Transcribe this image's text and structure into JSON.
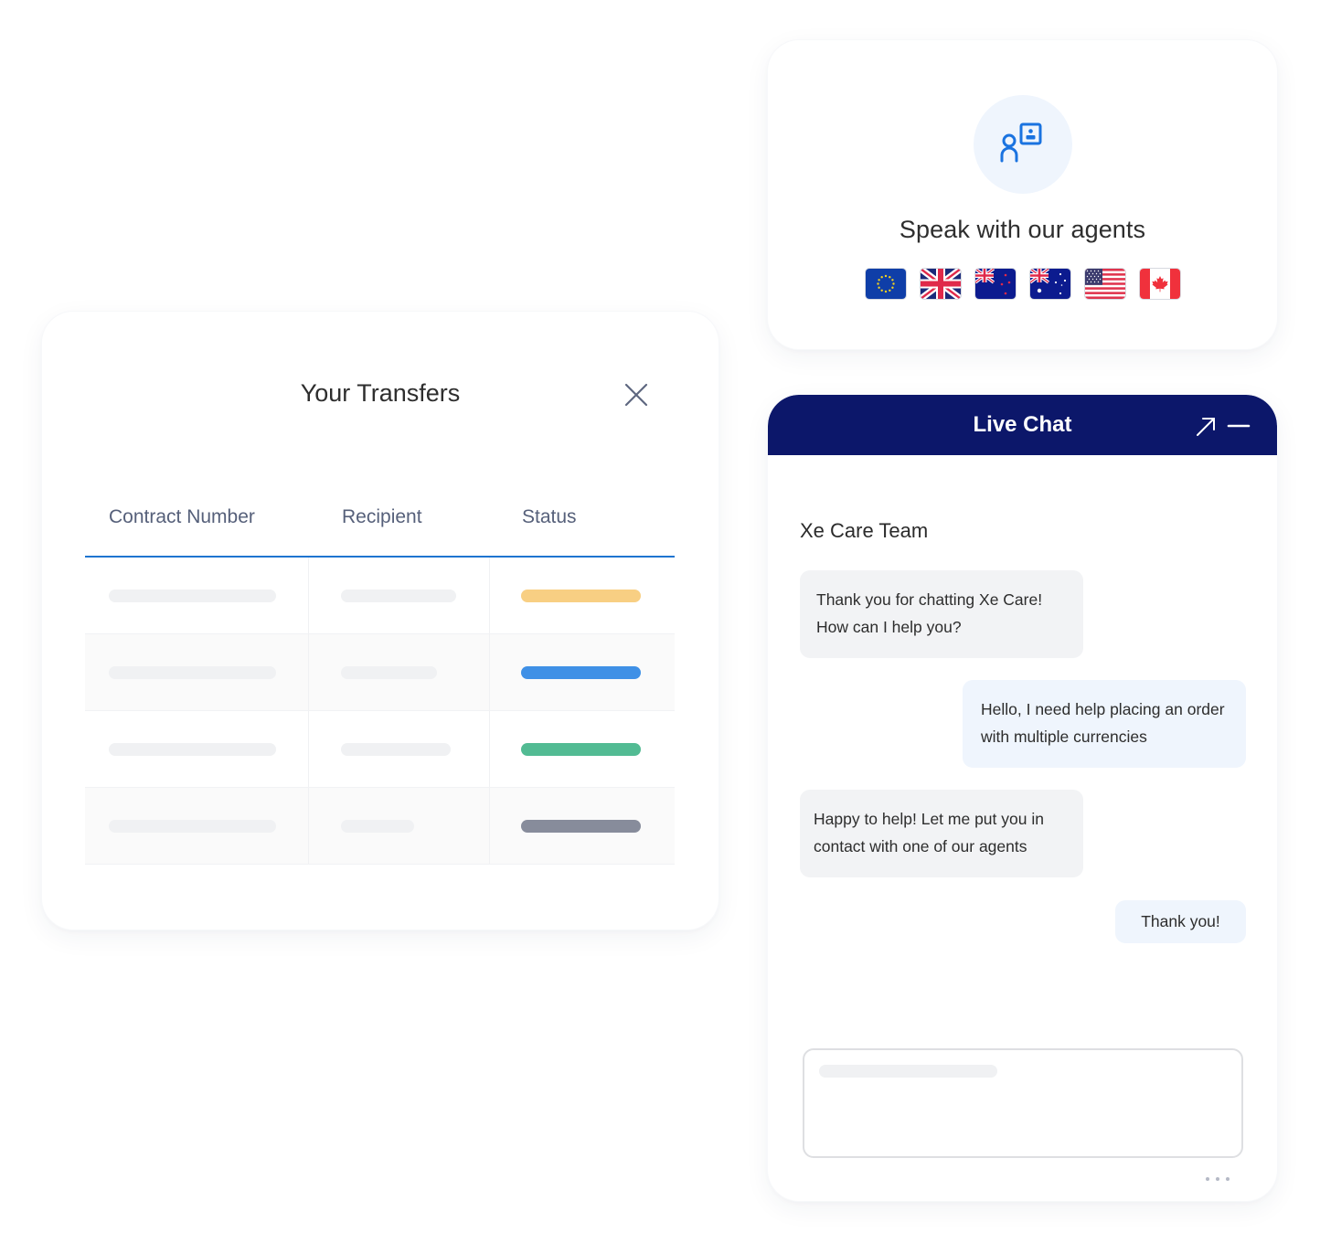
{
  "agents_card": {
    "icon": "agent-presentation-icon",
    "title": "Speak with our agents",
    "flags": [
      {
        "name": "flag-eu",
        "label": "European Union"
      },
      {
        "name": "flag-uk",
        "label": "United Kingdom"
      },
      {
        "name": "flag-nz",
        "label": "New Zealand"
      },
      {
        "name": "flag-au",
        "label": "Australia"
      },
      {
        "name": "flag-us",
        "label": "United States"
      },
      {
        "name": "flag-ca",
        "label": "Canada"
      }
    ]
  },
  "transfers": {
    "title": "Your Transfers",
    "close_icon": "close-icon",
    "columns": [
      "Contract Number",
      "Recipient",
      "Status"
    ],
    "rows": [
      {
        "status_color": "#f8cf83"
      },
      {
        "status_color": "#3f90e6"
      },
      {
        "status_color": "#52bb93"
      },
      {
        "status_color": "#878c9b"
      }
    ]
  },
  "chat": {
    "title": "Live Chat",
    "header_color": "#0c176a",
    "expand_icon": "expand-arrow-icon",
    "minimize_icon": "minimize-icon",
    "team_name": "Xe Care Team",
    "messages": [
      {
        "sender": "agent",
        "text": "Thank you for chatting Xe Care! How can I help you?"
      },
      {
        "sender": "user",
        "text": "Hello, I need help placing an order with multiple currencies"
      },
      {
        "sender": "agent",
        "text": "Happy to help! Let me put you in contact with one of our agents"
      },
      {
        "sender": "user",
        "text": "Thank you!"
      }
    ],
    "input_value": "",
    "typing_indicator": "typing-dots-icon"
  },
  "colors": {
    "accent_blue": "#1e74d0",
    "icon_blue": "#1a73e0"
  }
}
